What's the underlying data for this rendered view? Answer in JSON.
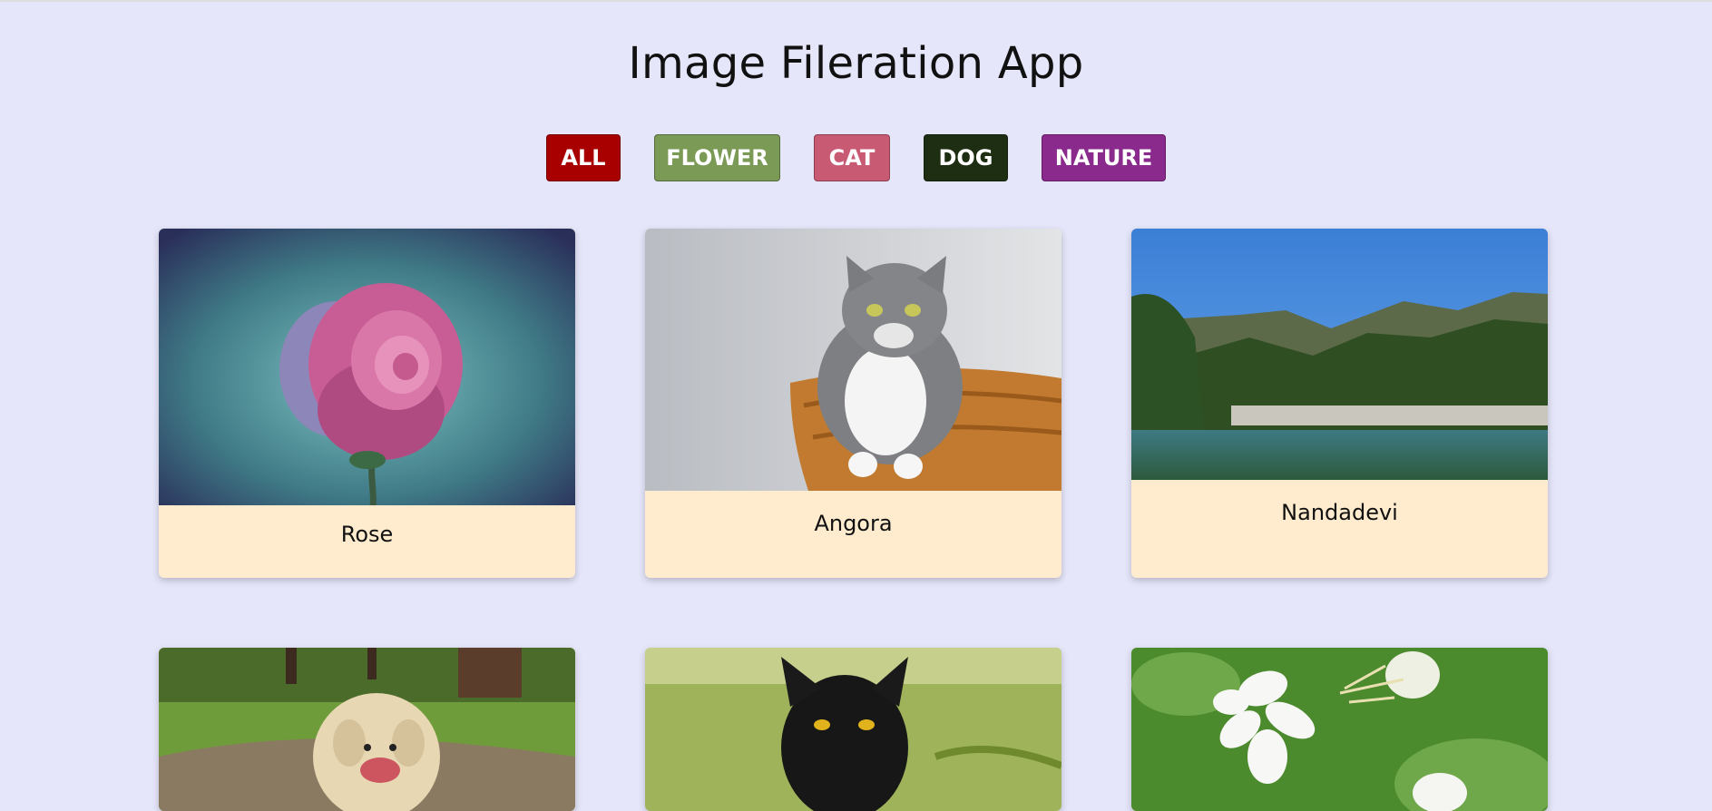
{
  "app": {
    "title": "Image Fileration App"
  },
  "filters": [
    {
      "label": "ALL",
      "color": "#a80000"
    },
    {
      "label": "FLOWER",
      "color": "#7a9a55"
    },
    {
      "label": "CAT",
      "color": "#c85a74"
    },
    {
      "label": "DOG",
      "color": "#1d2e12"
    },
    {
      "label": "NATURE",
      "color": "#8a2a8c"
    }
  ],
  "cards": [
    {
      "name": "Rose",
      "category": "flower",
      "image": "rose-image"
    },
    {
      "name": "Angora",
      "category": "cat",
      "image": "cat-image"
    },
    {
      "name": "Nandadevi",
      "category": "nature",
      "image": "mountain-lake-image"
    },
    {
      "name": "",
      "category": "dog",
      "image": "dog-image"
    },
    {
      "name": "",
      "category": "cat",
      "image": "black-cat-image"
    },
    {
      "name": "",
      "category": "flower",
      "image": "jasmine-image"
    }
  ]
}
